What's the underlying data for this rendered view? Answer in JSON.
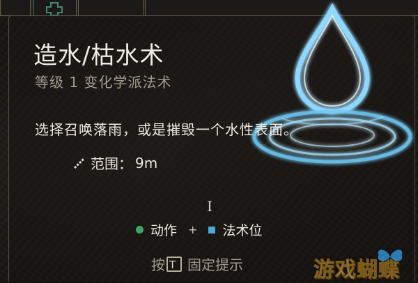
{
  "tooltip": {
    "title": "造水/枯水术",
    "subtitle": "等级 1 变化学派法术",
    "description": "选择召唤落雨，或是摧毁一个水性表面。",
    "range_label": "范围：",
    "range_value": "9m",
    "cost": {
      "action_label": "动作",
      "separator": "+",
      "slot_label": "法术位"
    },
    "pin_hint": {
      "prefix": "按",
      "key": "T",
      "suffix": "固定提示"
    }
  },
  "icons": {
    "range": "ruler-icon",
    "action": "action-dot-icon",
    "spell_slot": "spell-slot-icon",
    "spell_art": "water-drop-icon",
    "cursor": "text-cursor-icon"
  },
  "colors": {
    "action_dot": "#3fa46a",
    "spell_slot": "#4aa7d8",
    "title_text": "#f1ece4",
    "muted_text": "#a59c8f",
    "frame": "#5c4e3e",
    "water_glow": "#8fd8ff"
  },
  "watermark": {
    "text": "游戏蝴蝶"
  }
}
